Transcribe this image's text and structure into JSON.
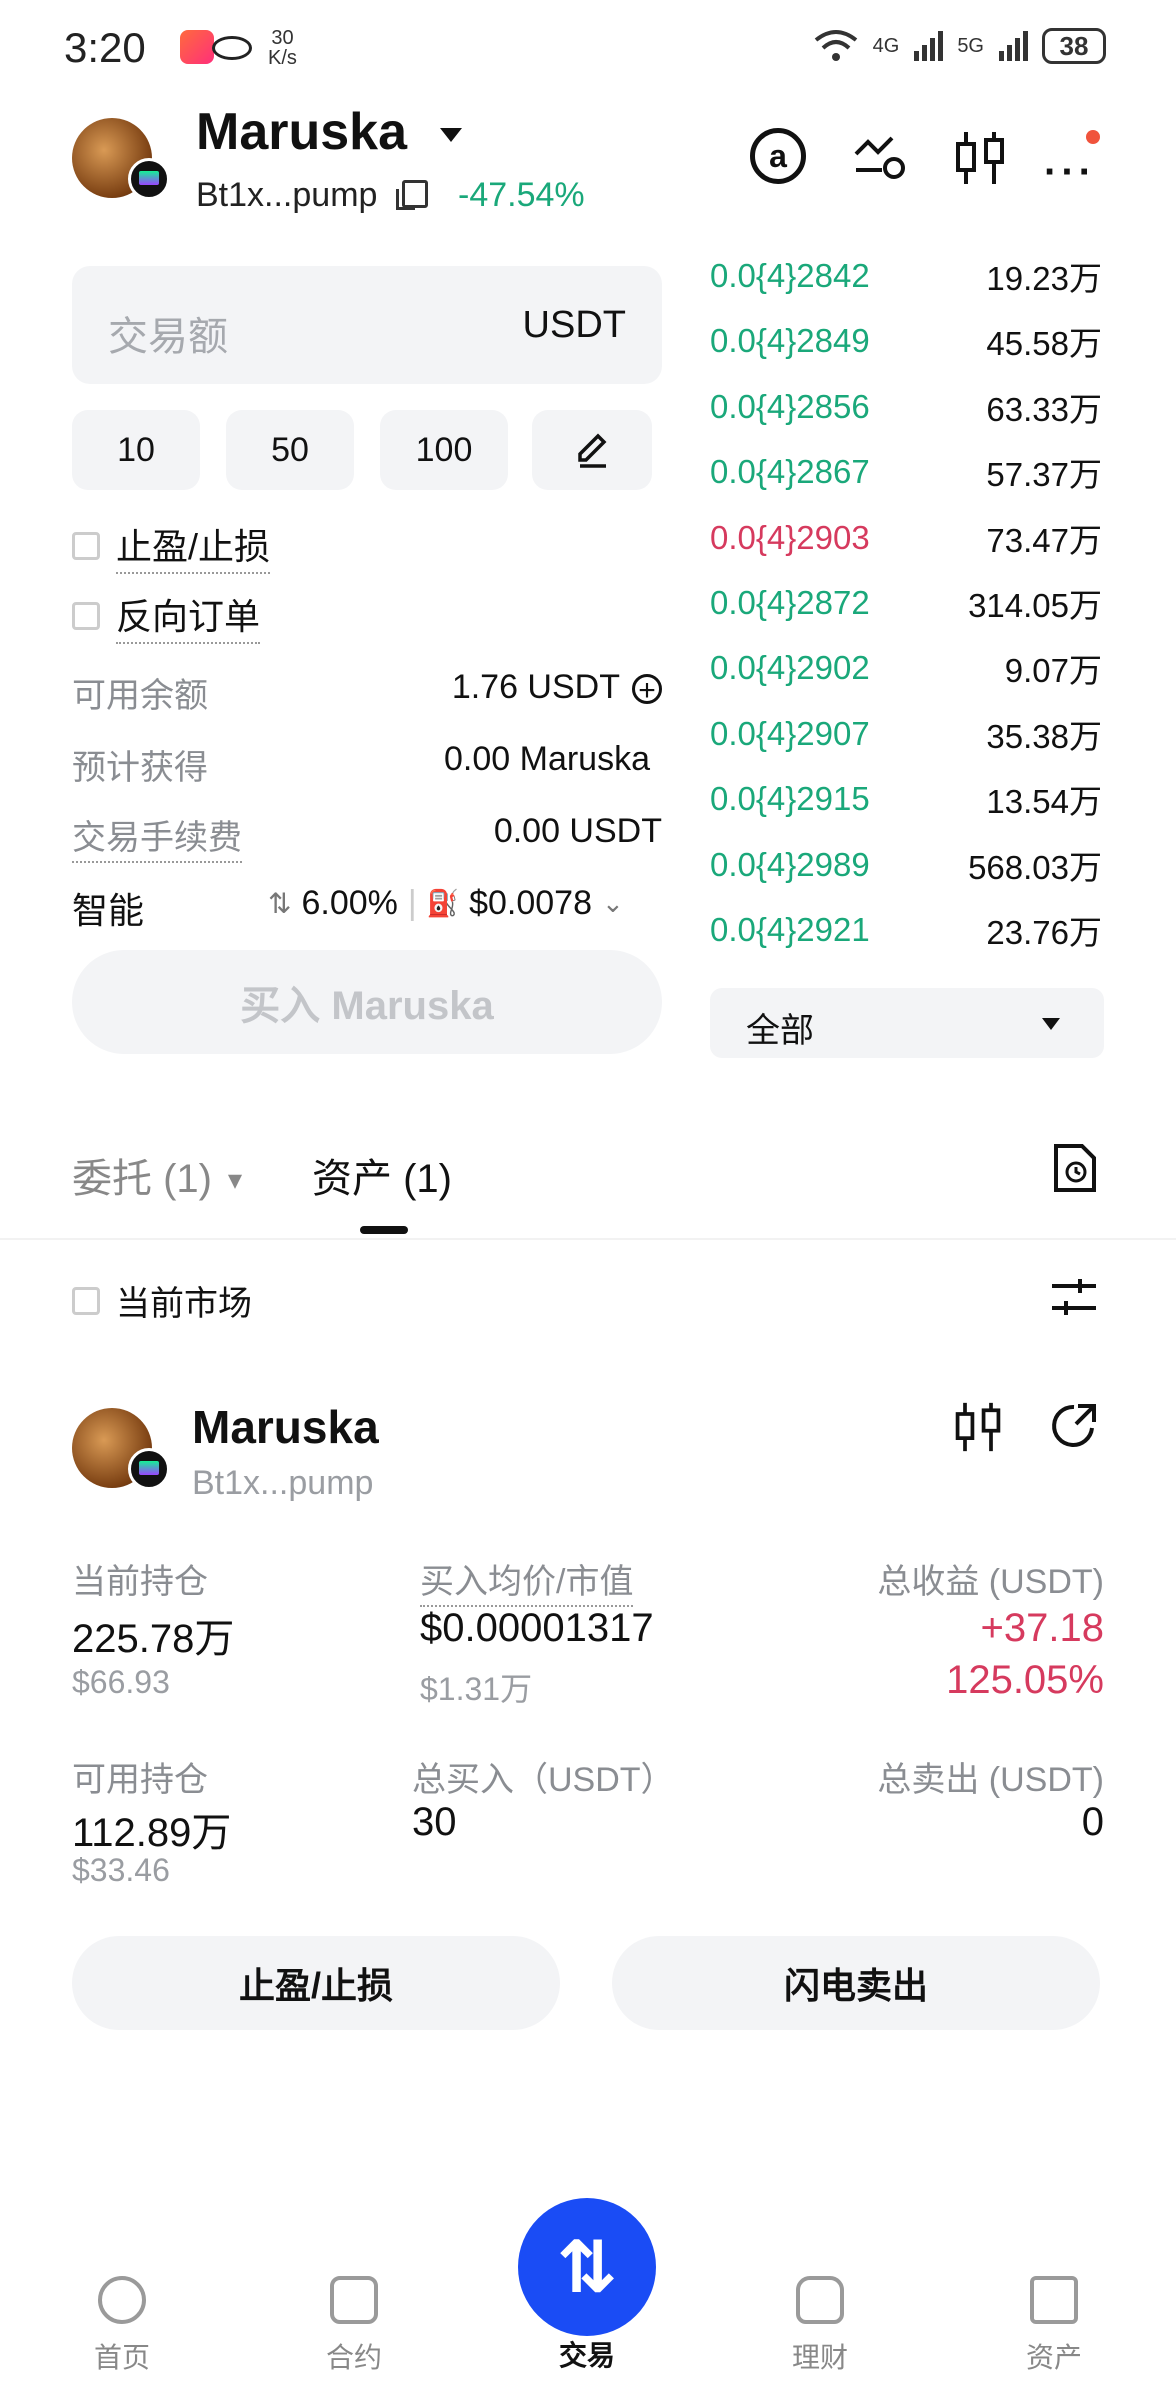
{
  "status_bar": {
    "time": "3:20",
    "speed_value": "30",
    "speed_unit": "K/s",
    "net1": "4G",
    "net2": "5G",
    "battery": "38"
  },
  "header": {
    "token_name": "Maruska",
    "address": "Bt1x...pump",
    "change": "-47.54%"
  },
  "trade_form": {
    "amount_placeholder": "交易额",
    "amount_unit": "USDT",
    "quick_amounts": [
      "10",
      "50",
      "100"
    ],
    "tp_sl_label": "止盈/止损",
    "reverse_order_label": "反向订单",
    "available_label": "可用余额",
    "available_value": "1.76 USDT",
    "expected_label": "预计获得",
    "expected_value": "0.00 Maruska",
    "fee_label": "交易手续费",
    "fee_value": "0.00 USDT",
    "smart_label": "智能",
    "slippage": "6.00%",
    "gas": "$0.0078",
    "buy_button": "买入 Maruska"
  },
  "order_book": {
    "rows": [
      {
        "price": "0.0{4}2842",
        "qty": "19.23万",
        "side": "buy"
      },
      {
        "price": "0.0{4}2849",
        "qty": "45.58万",
        "side": "buy"
      },
      {
        "price": "0.0{4}2856",
        "qty": "63.33万",
        "side": "buy"
      },
      {
        "price": "0.0{4}2867",
        "qty": "57.37万",
        "side": "buy"
      },
      {
        "price": "0.0{4}2903",
        "qty": "73.47万",
        "side": "sell"
      },
      {
        "price": "0.0{4}2872",
        "qty": "314.05万",
        "side": "buy"
      },
      {
        "price": "0.0{4}2902",
        "qty": "9.07万",
        "side": "buy"
      },
      {
        "price": "0.0{4}2907",
        "qty": "35.38万",
        "side": "buy"
      },
      {
        "price": "0.0{4}2915",
        "qty": "13.54万",
        "side": "buy"
      },
      {
        "price": "0.0{4}2989",
        "qty": "568.03万",
        "side": "buy"
      },
      {
        "price": "0.0{4}2921",
        "qty": "23.76万",
        "side": "buy"
      }
    ],
    "filter": "全部"
  },
  "tabs": {
    "orders": "委托 (1)",
    "assets": "资产 (1)"
  },
  "current_market_label": "当前市场",
  "holding": {
    "name": "Maruska",
    "address": "Bt1x...pump",
    "position_label": "当前持仓",
    "position_value": "225.78万",
    "position_usd": "$66.93",
    "avg_label": "买入均价/市值",
    "avg_value": "$0.00001317",
    "avg_mcap": "$1.31万",
    "pnl_label": "总收益 (USDT)",
    "pnl_value": "+37.18",
    "pnl_pct": "125.05%",
    "avail_label": "可用持仓",
    "avail_value": "112.89万",
    "avail_usd": "$33.46",
    "total_buy_label": "总买入（USDT）",
    "total_buy_value": "30",
    "total_sell_label": "总卖出 (USDT)",
    "total_sell_value": "0",
    "tp_sl_button": "止盈/止损",
    "flash_sell_button": "闪电卖出"
  },
  "bottom_nav": {
    "home": "首页",
    "contract": "合约",
    "trade": "交易",
    "finance": "理财",
    "assets": "资产"
  },
  "colors": {
    "green": "#1aa87a",
    "red": "#d63a5e",
    "accent": "#1a4cf5"
  }
}
